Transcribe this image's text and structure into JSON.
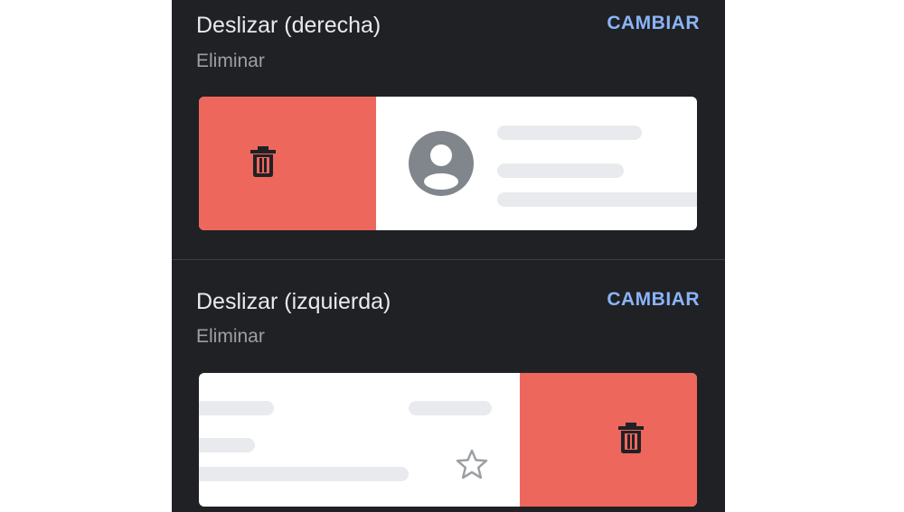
{
  "swipe_right": {
    "title": "Deslizar (derecha)",
    "action": "Eliminar",
    "change_label": "CAMBIAR"
  },
  "swipe_left": {
    "title": "Deslizar (izquierda)",
    "action": "Eliminar",
    "change_label": "CAMBIAR"
  },
  "colors": {
    "background": "#202124",
    "accent": "#8ab4f8",
    "delete_red": "#ee675c",
    "title_text": "#e8eaed",
    "subtitle_text": "#9aa0a6"
  },
  "icons": [
    "trash-icon",
    "avatar-icon",
    "star-icon"
  ]
}
